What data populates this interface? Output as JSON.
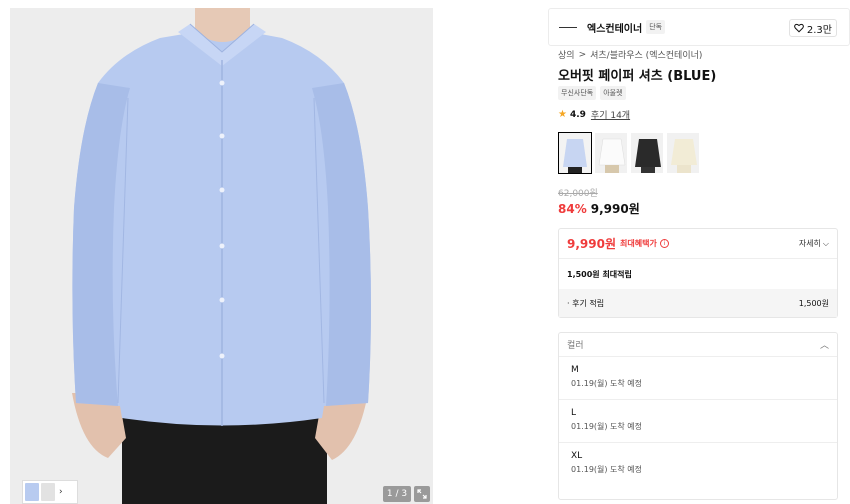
{
  "gallery": {
    "pager": "1 / 3",
    "thumb_colors": [
      "#b8cbf0",
      "#e8e8e8",
      "#ddd"
    ]
  },
  "brand": {
    "name": "엑스컨테이너",
    "badge": "단독",
    "likes": "2.3만"
  },
  "breadcrumb": {
    "category": "상의",
    "separator": ">",
    "subcategory": "셔츠/블라우스 (엑스컨테이너)"
  },
  "product": {
    "title": "오버핏 페이퍼 셔츠 (BLUE)",
    "tags": [
      "무신사단독",
      "아울렛"
    ],
    "rating": "4.9",
    "reviews": "후기 14개",
    "swatch_colors": [
      "#c7d5f2",
      "#f3f3f1",
      "#2a2a2a",
      "#f1ecd8"
    ]
  },
  "price": {
    "original": "62,000원",
    "discount": "84%",
    "sale": "9,990원"
  },
  "benefit": {
    "price": "9,990원",
    "label": "최대혜택가",
    "info_icon": "i",
    "detail": "자세히",
    "points": "1,500원 최대적립",
    "review_label": "· 후기 적립",
    "review_amount": "1,500원"
  },
  "options": {
    "placeholder": "컬러",
    "items": [
      {
        "size": "M",
        "eta": "01.19(월) 도착 예정"
      },
      {
        "size": "L",
        "eta": "01.19(월) 도착 예정"
      },
      {
        "size": "XL",
        "eta": "01.19(월) 도착 예정"
      }
    ]
  },
  "colors": {
    "accent_red": "#ef3b3b",
    "shirt_blue": "#b8cbf0"
  }
}
